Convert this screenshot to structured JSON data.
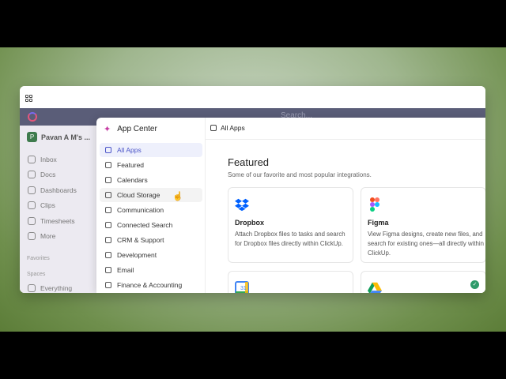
{
  "sidebar": {
    "workspace_initial": "P",
    "workspace_name": "Pavan A M's ...",
    "items": [
      {
        "label": "Inbox"
      },
      {
        "label": "Docs"
      },
      {
        "label": "Dashboards"
      },
      {
        "label": "Clips"
      },
      {
        "label": "Timesheets"
      },
      {
        "label": "More"
      }
    ],
    "favorites_label": "Favorites",
    "spaces_label": "Spaces",
    "everything_label": "Everything"
  },
  "topnav": {
    "search_placeholder": "Search..."
  },
  "app_center": {
    "title": "App Center",
    "categories": [
      {
        "label": "All Apps",
        "icon": "grid-icon"
      },
      {
        "label": "Featured",
        "icon": "heart-icon"
      },
      {
        "label": "Calendars",
        "icon": "calendar-icon"
      },
      {
        "label": "Cloud Storage",
        "icon": "cloud-icon"
      },
      {
        "label": "Communication",
        "icon": "chat-icon"
      },
      {
        "label": "Connected Search",
        "icon": "search-icon"
      },
      {
        "label": "CRM & Support",
        "icon": "phone-icon"
      },
      {
        "label": "Development",
        "icon": "code-icon"
      },
      {
        "label": "Email",
        "icon": "mail-icon"
      },
      {
        "label": "Finance & Accounting",
        "icon": "dollar-icon"
      }
    ],
    "breadcrumb": "All Apps",
    "featured_title": "Featured",
    "featured_subtitle": "Some of our favorite and most popular integrations.",
    "cards": [
      {
        "name": "Dropbox",
        "desc": "Attach Dropbox files to tasks and search for Dropbox files directly within ClickUp.",
        "logo": "dropbox-logo"
      },
      {
        "name": "Figma",
        "desc": "View Figma designs, create new files, and search for existing ones—all directly within ClickUp.",
        "logo": "figma-logo"
      },
      {
        "name": "",
        "desc": "",
        "logo": "google-calendar-logo"
      },
      {
        "name": "",
        "desc": "",
        "logo": "google-drive-logo",
        "installed": true
      }
    ]
  }
}
